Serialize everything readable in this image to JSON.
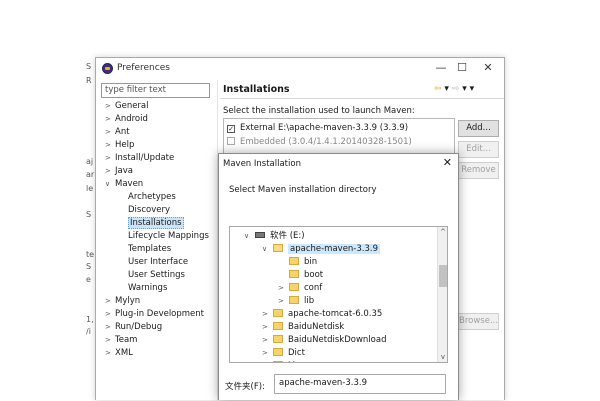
{
  "background": {
    "fragments": [
      "S",
      "R",
      "",
      "",
      "",
      "aj",
      "ar",
      "le",
      "",
      "",
      "",
      "S",
      "",
      "te",
      "S",
      "e",
      "",
      "",
      "",
      "1,",
      "/i",
      ""
    ]
  },
  "preferences": {
    "title": "Preferences",
    "window_controls": {
      "minimize": "—",
      "maximize": "☐",
      "close": "✕"
    },
    "filter_placeholder": "type filter text",
    "tree": [
      {
        "label": "General",
        "arrow": ">",
        "indent": 0
      },
      {
        "label": "Android",
        "arrow": ">",
        "indent": 0
      },
      {
        "label": "Ant",
        "arrow": ">",
        "indent": 0
      },
      {
        "label": "Help",
        "arrow": ">",
        "indent": 0
      },
      {
        "label": "Install/Update",
        "arrow": ">",
        "indent": 0
      },
      {
        "label": "Java",
        "arrow": ">",
        "indent": 0
      },
      {
        "label": "Maven",
        "arrow": "v",
        "indent": 0
      },
      {
        "label": "Archetypes",
        "arrow": "",
        "indent": 1
      },
      {
        "label": "Discovery",
        "arrow": "",
        "indent": 1
      },
      {
        "label": "Installations",
        "arrow": "",
        "indent": 1,
        "selected": true
      },
      {
        "label": "Lifecycle Mappings",
        "arrow": "",
        "indent": 1
      },
      {
        "label": "Templates",
        "arrow": "",
        "indent": 1
      },
      {
        "label": "User Interface",
        "arrow": "",
        "indent": 1
      },
      {
        "label": "User Settings",
        "arrow": "",
        "indent": 1
      },
      {
        "label": "Warnings",
        "arrow": "",
        "indent": 1
      },
      {
        "label": "Mylyn",
        "arrow": ">",
        "indent": 0
      },
      {
        "label": "Plug-in Development",
        "arrow": ">",
        "indent": 0
      },
      {
        "label": "Run/Debug",
        "arrow": ">",
        "indent": 0
      },
      {
        "label": "Team",
        "arrow": ">",
        "indent": 0
      },
      {
        "label": "XML",
        "arrow": ">",
        "indent": 0
      }
    ],
    "page_title": "Installations",
    "nav_icons": "⇦ ▾ ⇨ ▾ ▾",
    "select_label": "Select the installation used to launch Maven:",
    "installations": [
      {
        "label": "External E:\\apache-maven-3.3.9 (3.3.9)",
        "checked": true,
        "enabled": true
      },
      {
        "label": "Embedded (3.0.4/1.4.1.20140328-1501)",
        "checked": false,
        "enabled": false
      }
    ],
    "buttons": {
      "add": "Add...",
      "edit": "Edit...",
      "remove": "Remove",
      "browse": "Browse..."
    }
  },
  "dialog": {
    "title": "Maven Installation",
    "close": "✕",
    "message": "Select Maven installation directory",
    "tree": [
      {
        "label": "软件 (E:)",
        "arrow": "v",
        "type": "drive",
        "indent": 0
      },
      {
        "label": "apache-maven-3.3.9",
        "arrow": "v",
        "type": "folder-open",
        "indent": 1,
        "selected": true
      },
      {
        "label": "bin",
        "arrow": "",
        "type": "folder",
        "indent": 2
      },
      {
        "label": "boot",
        "arrow": "",
        "type": "folder",
        "indent": 2
      },
      {
        "label": "conf",
        "arrow": ">",
        "type": "folder",
        "indent": 2
      },
      {
        "label": "lib",
        "arrow": ">",
        "type": "folder",
        "indent": 2
      },
      {
        "label": "apache-tomcat-6.0.35",
        "arrow": ">",
        "type": "folder",
        "indent": 1
      },
      {
        "label": "BaiduNetdisk",
        "arrow": ">",
        "type": "folder",
        "indent": 1
      },
      {
        "label": "BaiduNetdiskDownload",
        "arrow": ">",
        "type": "folder",
        "indent": 1
      },
      {
        "label": "Dict",
        "arrow": ">",
        "type": "folder",
        "indent": 1
      },
      {
        "label": "M...",
        "arrow": ">",
        "type": "folder",
        "indent": 1
      }
    ],
    "scroll_up": "^",
    "scroll_down": "v",
    "folder_label": "文件夹(F):",
    "folder_value": "apache-maven-3.3.9"
  }
}
